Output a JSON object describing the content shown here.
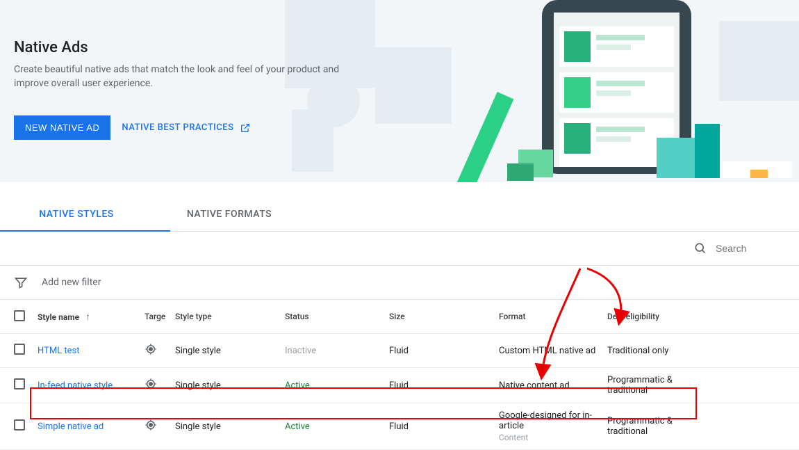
{
  "hero": {
    "title": "Native Ads",
    "subtitle": "Create beautiful native ads that match the look and feel of your product and improve overall user experience.",
    "primary_button": "NEW NATIVE AD",
    "secondary_link": "NATIVE BEST PRACTICES"
  },
  "tabs": {
    "styles": "NATIVE STYLES",
    "formats": "NATIVE FORMATS",
    "active": "styles"
  },
  "search": {
    "placeholder": "Search"
  },
  "filter": {
    "add_text": "Add new filter"
  },
  "columns": {
    "name": "Style name",
    "target": "Targe",
    "type": "Style type",
    "status": "Status",
    "size": "Size",
    "format": "Format",
    "deal": "Deal eligibility"
  },
  "rows": [
    {
      "name": "HTML test",
      "type": "Single style",
      "status": "Inactive",
      "status_class": "inactive",
      "size": "Fluid",
      "format": "Custom HTML native ad",
      "format_sub": "",
      "deal": "Traditional only"
    },
    {
      "name": "In-feed native style",
      "type": "Single style",
      "status": "Active",
      "status_class": "active",
      "size": "Fluid",
      "format": "Native content ad",
      "format_sub": "",
      "deal": "Programmatic & traditional"
    },
    {
      "name": "Simple native ad",
      "type": "Single style",
      "status": "Active",
      "status_class": "active",
      "size": "Fluid",
      "format": "Google-designed for in-article",
      "format_sub": "Content",
      "deal": "Programmatic & traditional"
    }
  ]
}
